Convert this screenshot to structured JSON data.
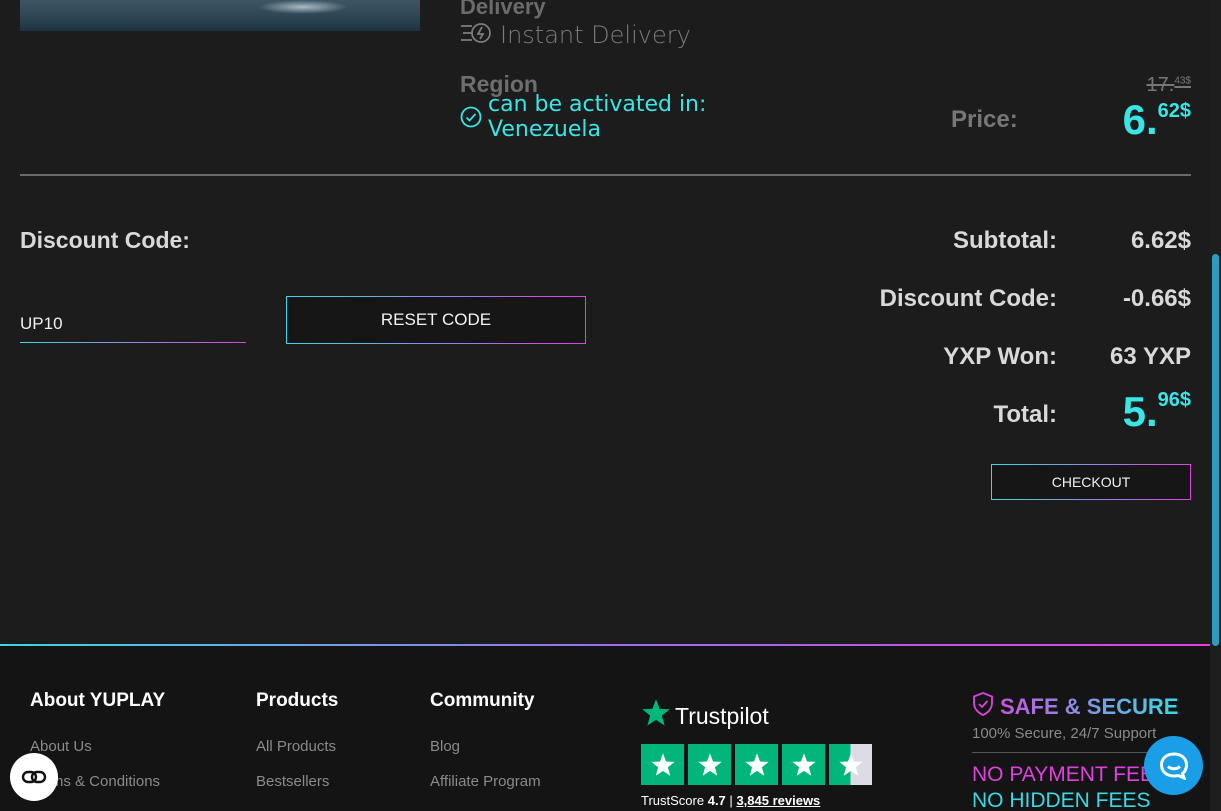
{
  "product": {
    "delivery_heading": "Delivery",
    "delivery_value": "Instant Delivery",
    "region_heading": "Region",
    "activation_text": "can be activated in: Venezuela",
    "old_price_major": "17.",
    "old_price_minor": "43$",
    "price_label": "Price:",
    "price_major": "6.",
    "price_minor": "62$"
  },
  "discount": {
    "label": "Discount Code:",
    "input_value": "UP10",
    "reset_label": "RESET CODE"
  },
  "summary": {
    "subtotal_label": "Subtotal:",
    "subtotal_value": "6.62$",
    "discount_label": "Discount Code:",
    "discount_value": "-0.66$",
    "yxp_label": "YXP Won:",
    "yxp_value": "63 YXP",
    "total_label": "Total:",
    "total_major": "5.",
    "total_minor": "96$",
    "checkout_label": "CHECKOUT"
  },
  "footer": {
    "columns": [
      {
        "title": "About YUPLAY",
        "links": [
          "About Us",
          "Terms & Conditions"
        ]
      },
      {
        "title": "Products",
        "links": [
          "All Products",
          "Bestsellers"
        ]
      },
      {
        "title": "Community",
        "links": [
          "Blog",
          "Affiliate Program"
        ]
      }
    ],
    "trustpilot": {
      "brand": "Trustpilot",
      "score_label": "TrustScore",
      "score": "4.7",
      "separator": "|",
      "reviews": "3,845 reviews",
      "rating": 4.5
    },
    "safe": {
      "title": "SAFE & SECURE",
      "subtitle": "100% Secure, 24/7 Support",
      "no_payment": "NO PAYMENT FEES",
      "no_hidden": "NO HIDDEN FEES"
    }
  },
  "colors": {
    "accent_cyan": "#39e6e6",
    "accent_magenta": "#e040e0",
    "trustpilot_green": "#00b67a",
    "chat_blue": "#1a9ee8"
  },
  "icons": {
    "delivery": "instant-delivery-icon",
    "check": "check-circle-icon",
    "trustpilot_star": "star-icon",
    "shield": "shield-check-icon",
    "chat": "chat-bubble-icon",
    "accessibility": "accessibility-link-icon"
  }
}
